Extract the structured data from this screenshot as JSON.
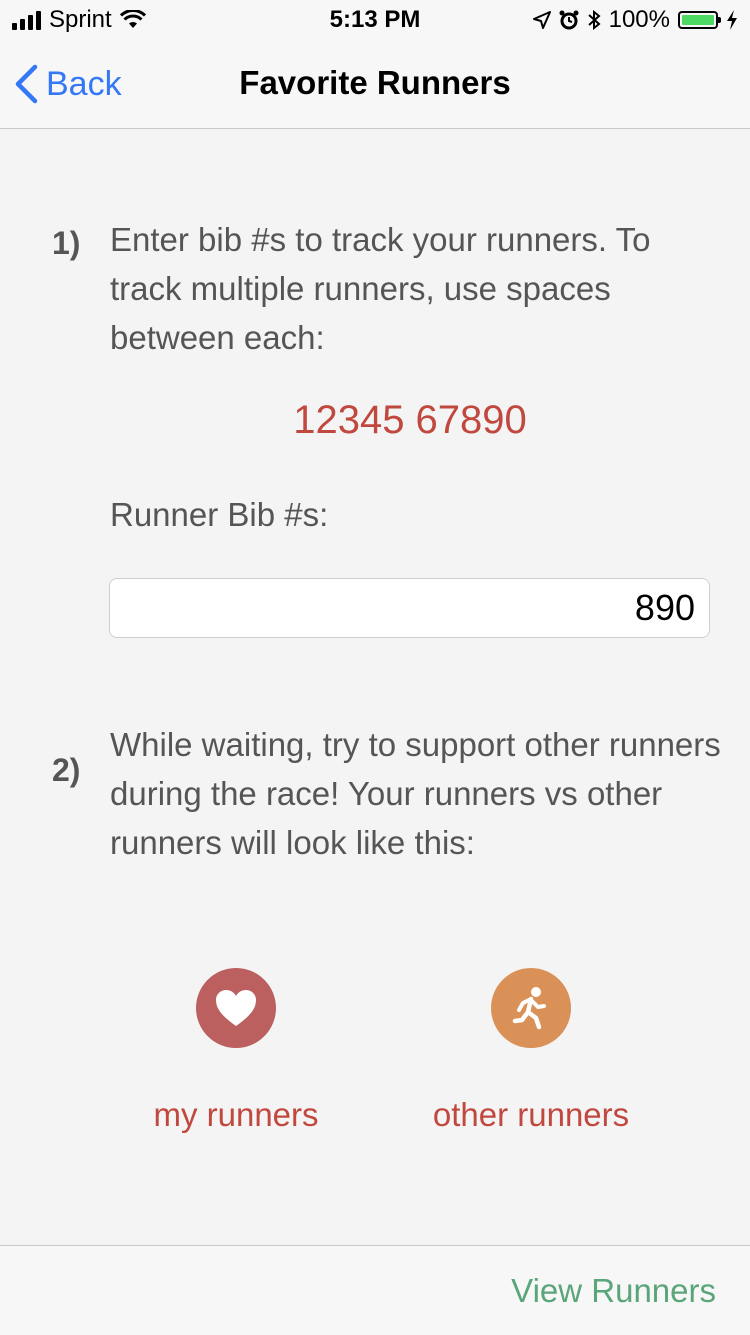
{
  "status_bar": {
    "carrier": "Sprint",
    "time": "5:13 PM",
    "battery": "100%",
    "icons": [
      "signal-icon",
      "wifi-icon",
      "location-icon",
      "alarm-icon",
      "bluetooth-icon",
      "battery-icon",
      "charging-icon"
    ]
  },
  "nav": {
    "back_label": "Back",
    "title": "Favorite Runners"
  },
  "step1": {
    "number": "1)",
    "text": "Enter bib #s to track your runners. To track multiple runners, use spaces between each:",
    "example": "12345 67890",
    "input_label": "Runner Bib #s:",
    "input_value": "890"
  },
  "step2": {
    "number": "2)",
    "text": "While waiting, try to support other runners during the race! Your runners vs other runners will look like this:"
  },
  "legend": {
    "my_runners": {
      "label": "my runners",
      "icon": "heart-icon",
      "color": "#bb5f5f"
    },
    "other_runners": {
      "label": "other runners",
      "icon": "runner-icon",
      "color": "#d99158"
    }
  },
  "bottom": {
    "view_runners_label": "View Runners"
  },
  "colors": {
    "accent_red": "#c1483e",
    "link_blue": "#3478f6",
    "action_green": "#5aa579"
  }
}
